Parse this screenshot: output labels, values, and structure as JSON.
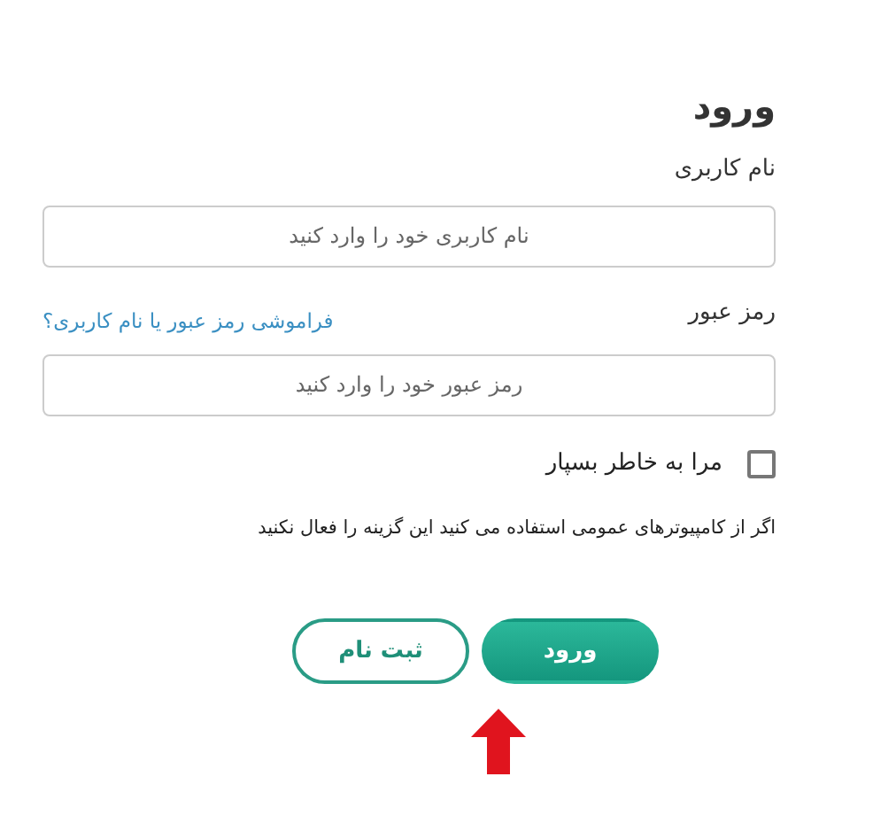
{
  "title": "ورود",
  "username": {
    "label": "نام کاربری",
    "placeholder": "نام کاربری خود را وارد کنید"
  },
  "password": {
    "label": "رمز عبور",
    "forgot_link": "فراموشی رمز عبور یا نام کاربری؟",
    "placeholder": "رمز عبور خود را وارد کنید"
  },
  "remember_me": {
    "label": "مرا به خاطر بسپار",
    "checked": false
  },
  "note": "اگر از کامپیوترهای عمومی استفاده می کنید این گزینه را فعال نکنید",
  "buttons": [
    {
      "kind": "primary",
      "label": "ورود"
    },
    {
      "kind": "outline",
      "label": "ثبت نام"
    }
  ]
}
